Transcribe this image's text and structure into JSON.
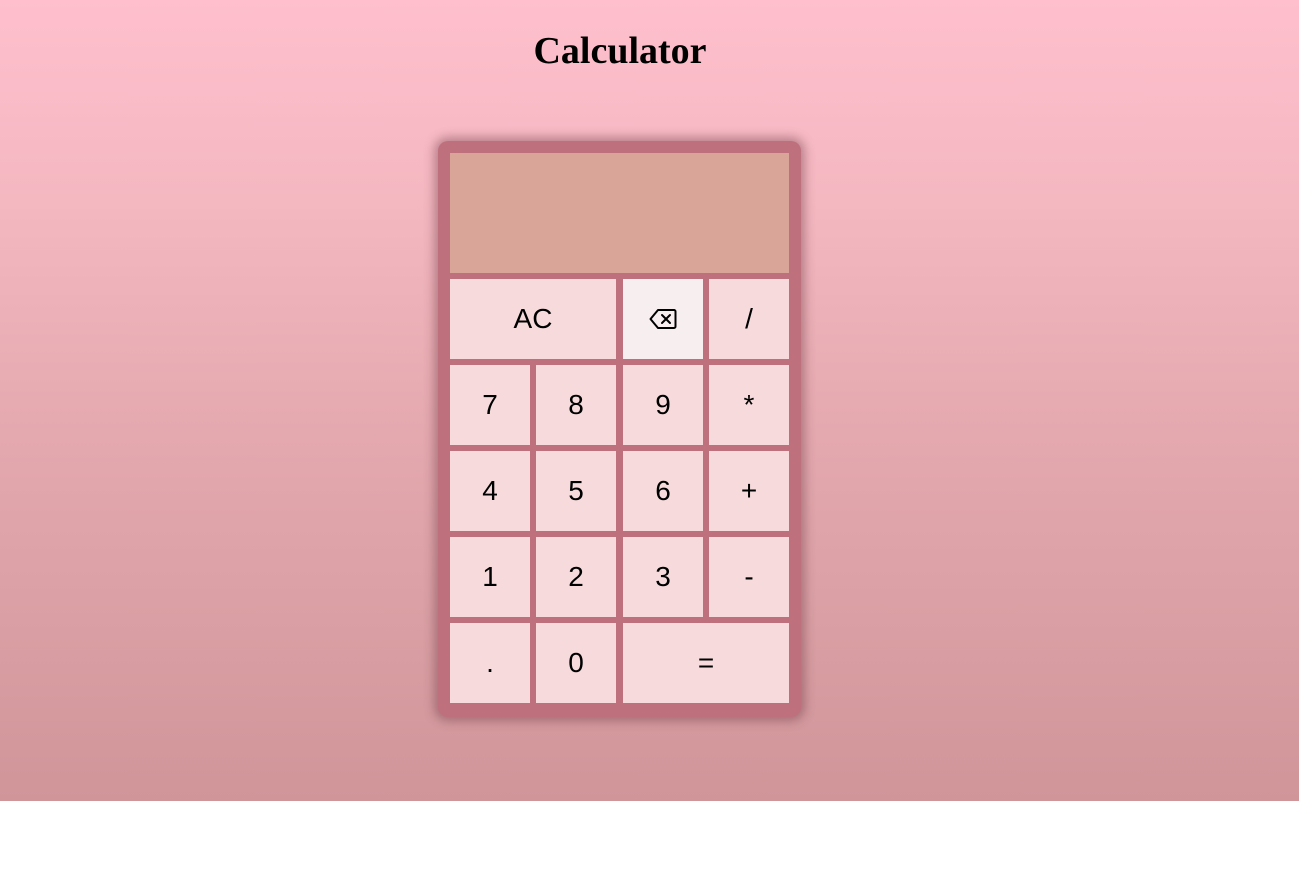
{
  "page": {
    "title": "Calculator"
  },
  "display": {
    "value": ""
  },
  "keys": {
    "ac": "AC",
    "backspace_icon": "backspace-icon",
    "divide": "/",
    "seven": "7",
    "eight": "8",
    "nine": "9",
    "multiply": "*",
    "four": "4",
    "five": "5",
    "six": "6",
    "plus": "+",
    "one": "1",
    "two": "2",
    "three": "3",
    "minus": "-",
    "decimal": ".",
    "zero": "0",
    "equals": "="
  },
  "colors": {
    "background_top": "#ffbfcd",
    "background_bottom": "#cf9599",
    "calculator_body": "#bf707d",
    "display": "#d9a599",
    "key": "#f7dadb",
    "key_highlight": "#f7eef0"
  }
}
